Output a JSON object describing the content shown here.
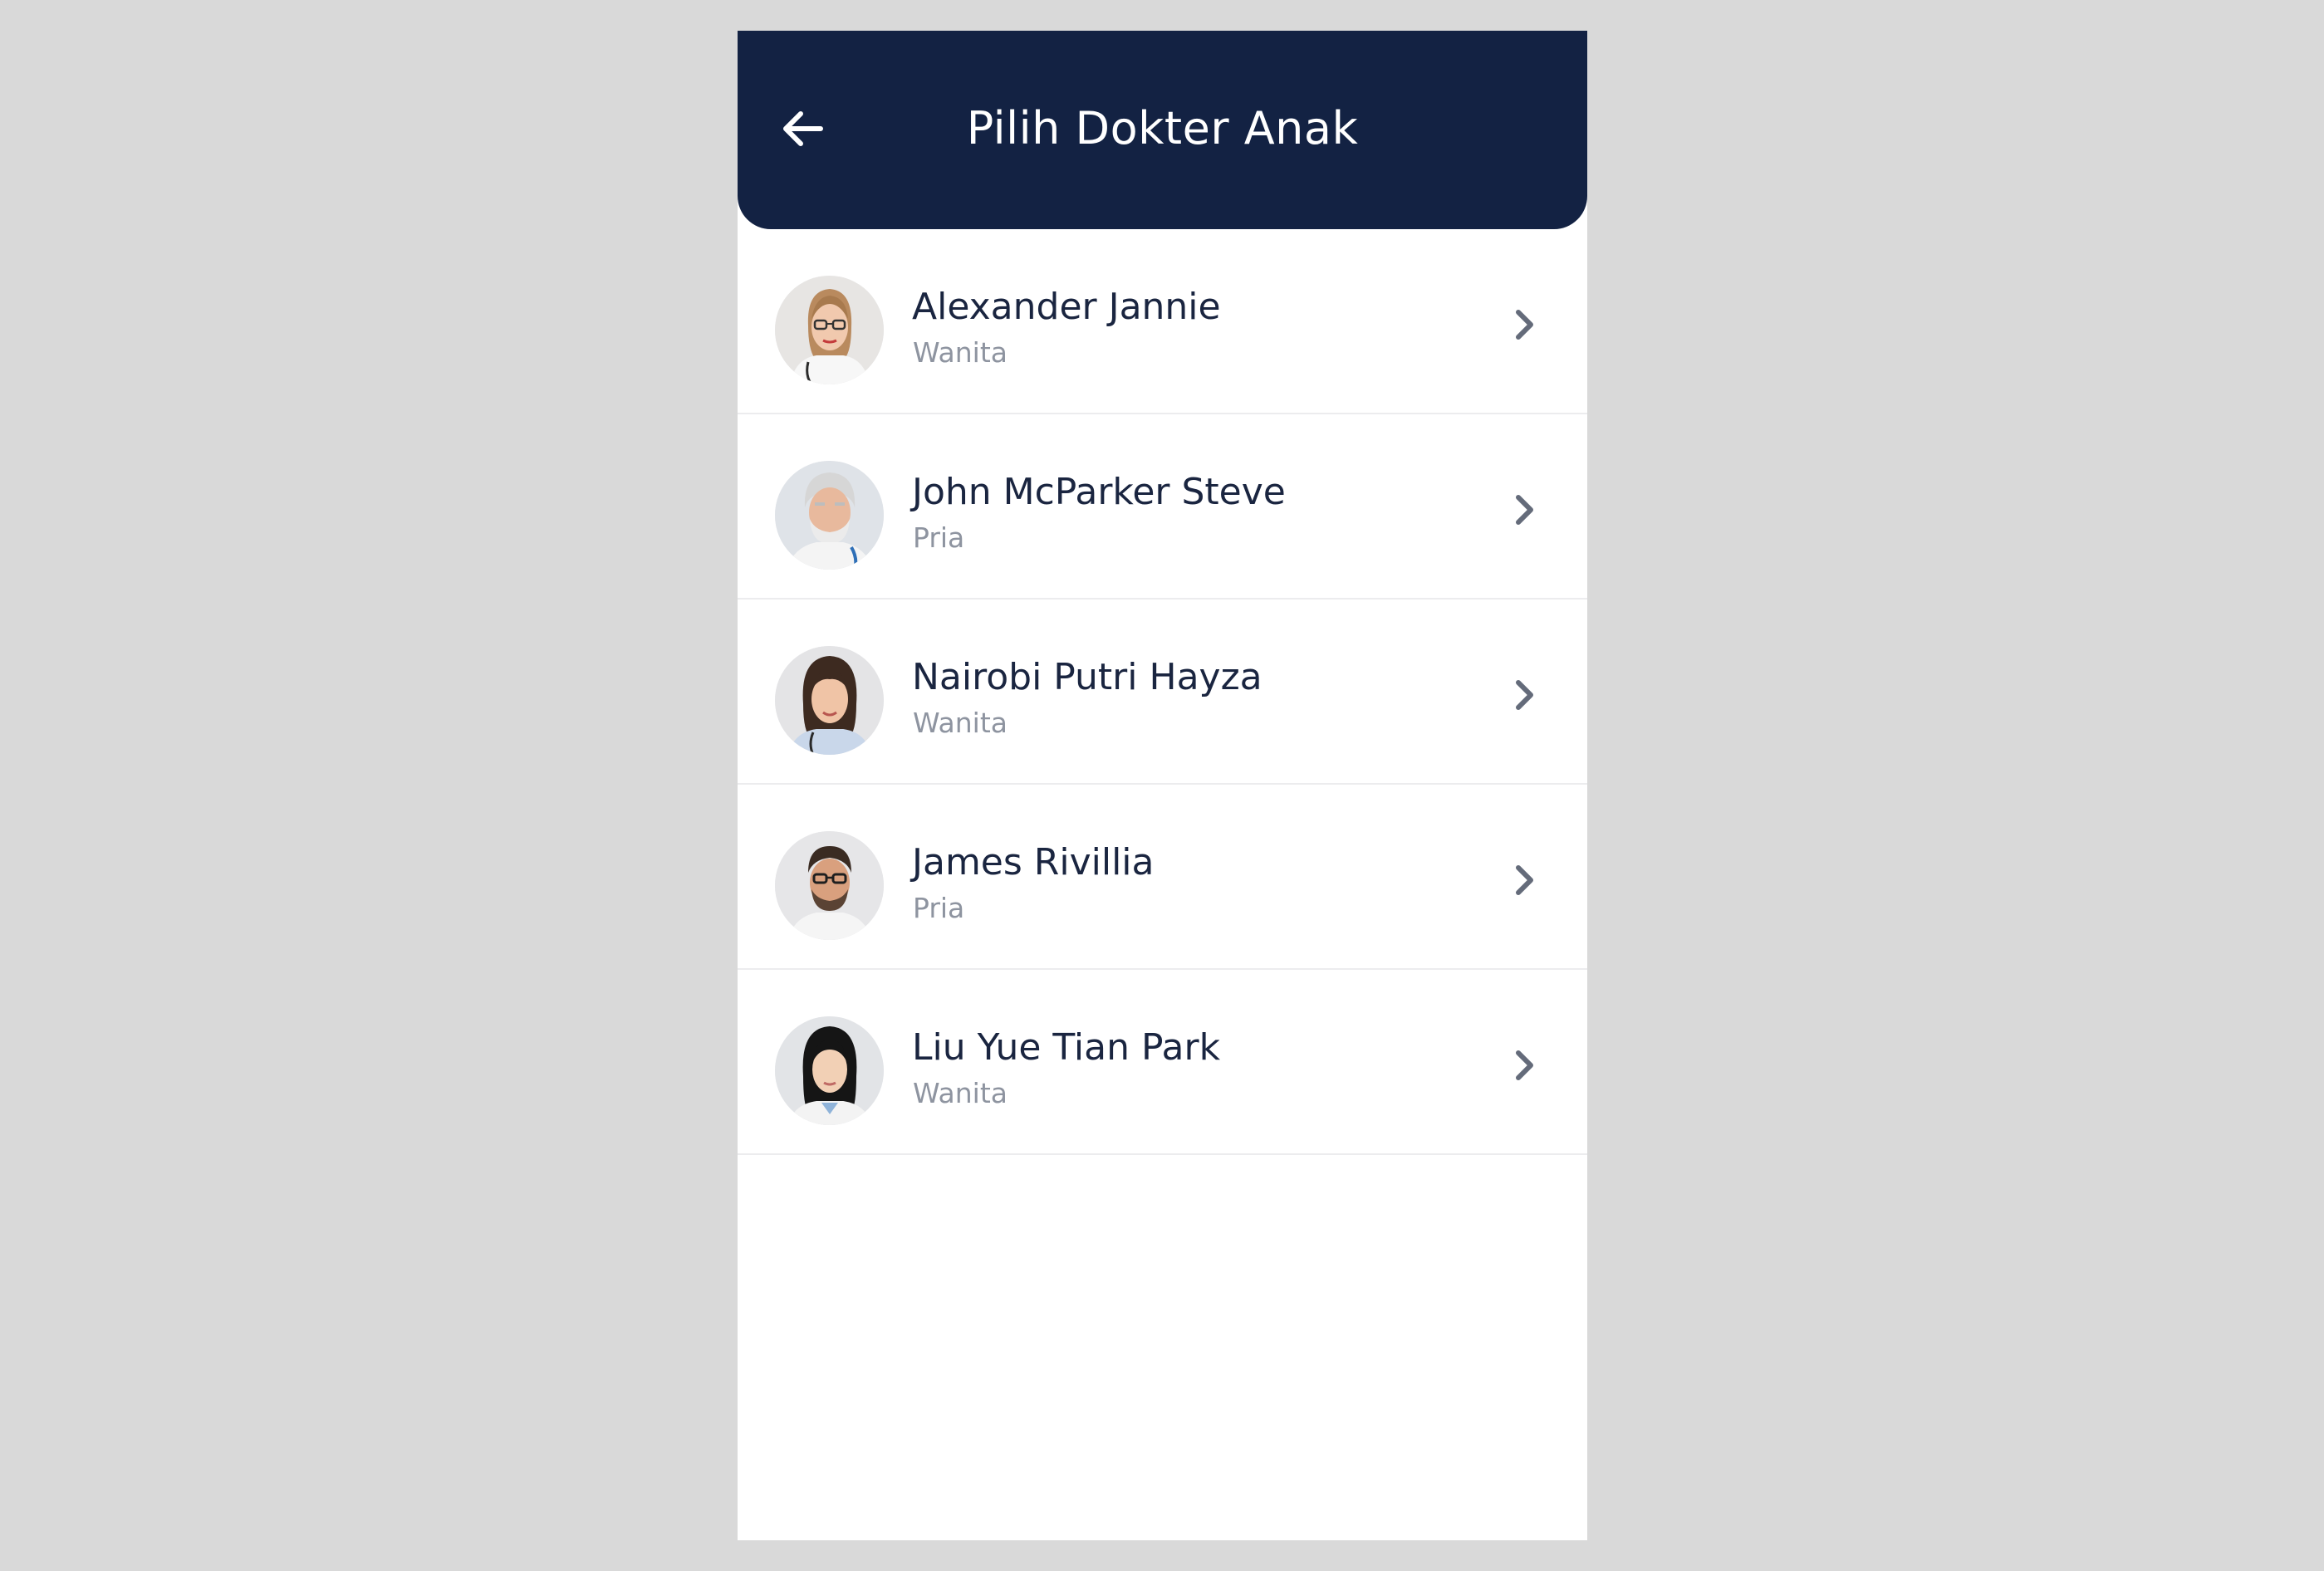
{
  "header": {
    "title": "Pilih Dokter Anak",
    "back_icon": "arrow-left-icon",
    "background_color": "#132243"
  },
  "doctors": [
    {
      "name": "Alexander Jannie",
      "gender": "Wanita",
      "avatar": "doctor-photo"
    },
    {
      "name": "John McParker Steve",
      "gender": "Pria",
      "avatar": "doctor-photo"
    },
    {
      "name": "Nairobi Putri Hayza",
      "gender": "Wanita",
      "avatar": "doctor-photo"
    },
    {
      "name": "James Rivillia",
      "gender": "Pria",
      "avatar": "doctor-photo"
    },
    {
      "name": "Liu Yue Tian Park",
      "gender": "Wanita",
      "avatar": "doctor-photo"
    }
  ],
  "item_icon": "chevron-right-icon"
}
